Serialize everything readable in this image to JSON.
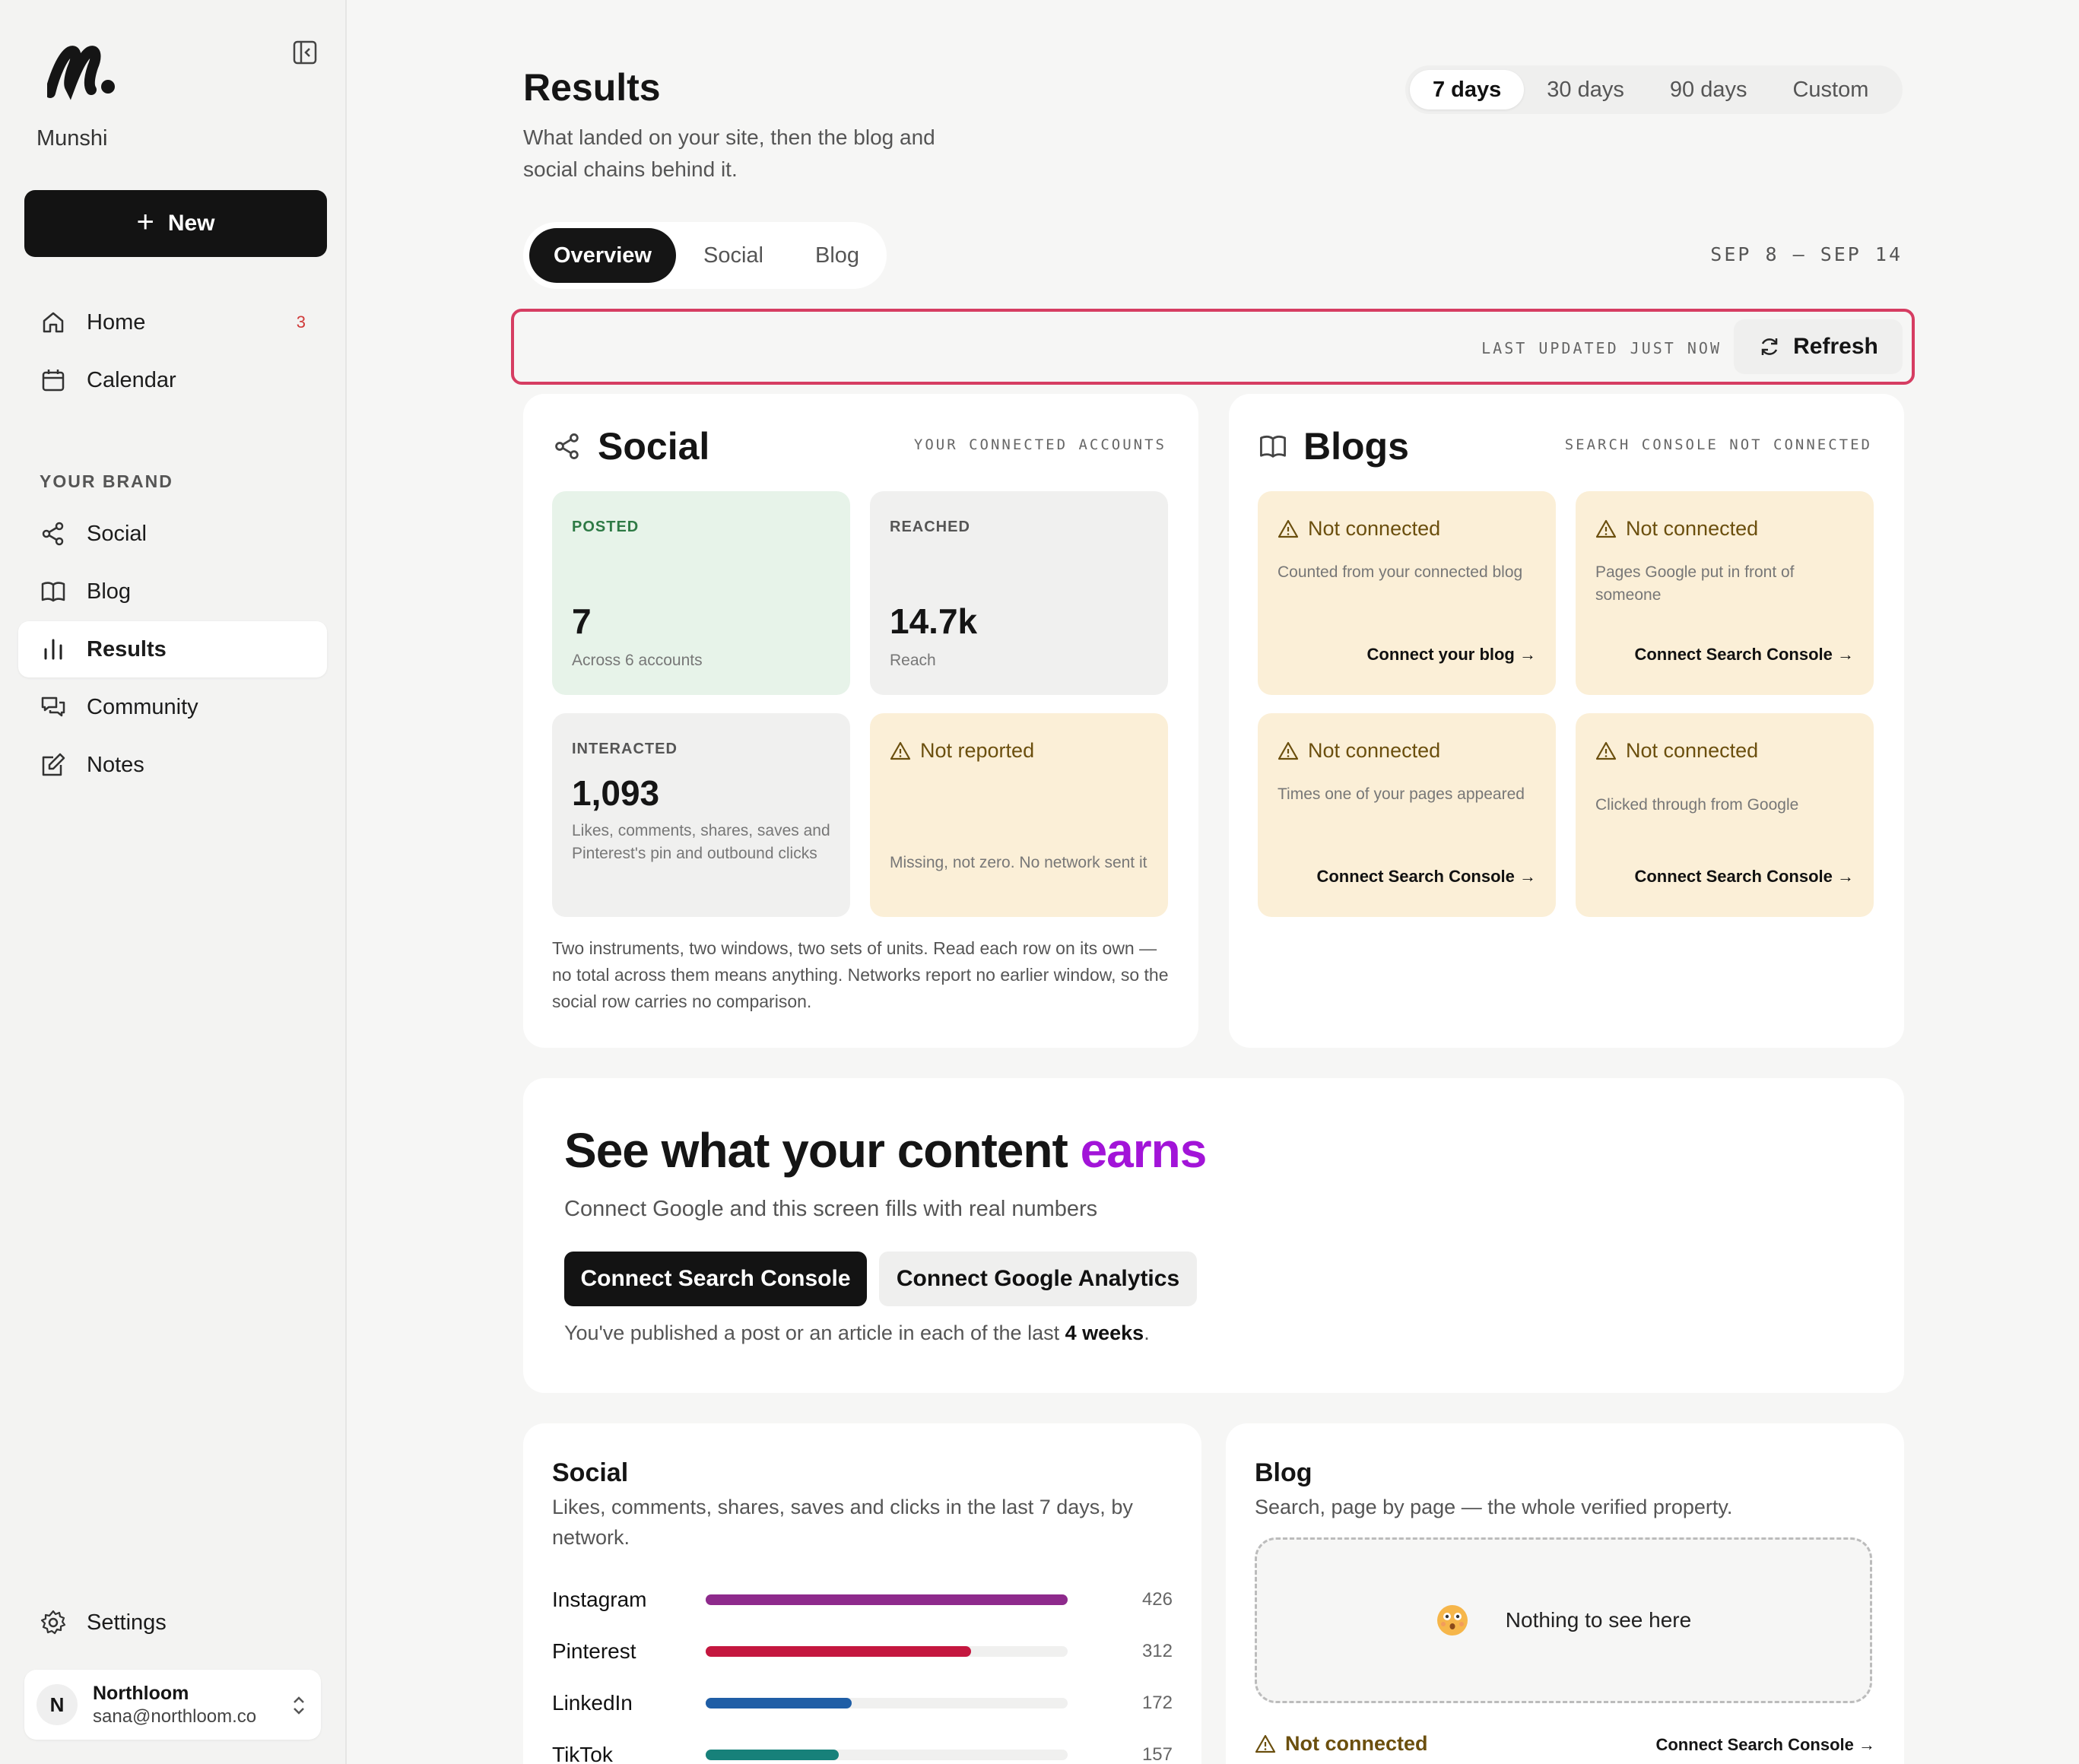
{
  "sidebar": {
    "brand": "Munshi",
    "new_label": "New",
    "nav": [
      {
        "label": "Home",
        "badge": "3"
      },
      {
        "label": "Calendar"
      }
    ],
    "section_label": "YOUR BRAND",
    "brand_nav": [
      {
        "label": "Social"
      },
      {
        "label": "Blog"
      },
      {
        "label": "Results"
      },
      {
        "label": "Community"
      },
      {
        "label": "Notes"
      }
    ],
    "settings_label": "Settings",
    "user": {
      "initial": "N",
      "name": "Northloom",
      "email": "sana@northloom.co"
    }
  },
  "header": {
    "title": "Results",
    "subtitle": "What landed on your site, then the blog and social chains behind it.",
    "ranges": [
      "7 days",
      "30 days",
      "90 days",
      "Custom"
    ],
    "active_range": "7 days",
    "views": [
      "Overview",
      "Social",
      "Blog"
    ],
    "active_view": "Overview",
    "date_range": "SEP 8 – SEP 14",
    "last_updated": "LAST UPDATED JUST NOW",
    "refresh_label": "Refresh"
  },
  "social_card": {
    "title": "Social",
    "meta": "YOUR CONNECTED ACCOUNTS",
    "posted": {
      "label": "POSTED",
      "value": "7",
      "caption": "Across 6 accounts"
    },
    "reached": {
      "label": "REACHED",
      "value": "14.7k",
      "caption": "Reach"
    },
    "interacted": {
      "label": "INTERACTED",
      "value": "1,093",
      "caption": "Likes, comments, shares, saves and Pinterest's pin and outbound clicks"
    },
    "not_reported": {
      "title": "Not reported",
      "caption": "Missing, not zero. No network sent it"
    },
    "footnote": "Two instruments, two windows, two sets of units. Read each row on its own — no total across them means anything. Networks report no earlier window, so the social row carries no comparison."
  },
  "blogs_card": {
    "title": "Blogs",
    "meta": "SEARCH CONSOLE NOT CONNECTED",
    "tiles": [
      {
        "title": "Not connected",
        "caption": "Counted from your connected blog",
        "link": "Connect your blog →"
      },
      {
        "title": "Not connected",
        "caption": "Pages Google put in front of someone",
        "link": "Connect Search Console →"
      },
      {
        "title": "Not connected",
        "caption": "Times one of your pages appeared",
        "link": "Connect Search Console →"
      },
      {
        "title": "Not connected",
        "caption": "Clicked through from Google",
        "link": "Connect Search Console →"
      }
    ]
  },
  "cta": {
    "title_main": "See what your content",
    "title_accent": "earns",
    "subtitle": "Connect Google and this screen fills with real numbers",
    "primary_button": "Connect Search Console",
    "secondary_button": "Connect Google Analytics",
    "note_prefix": "You've published a post or an article in each of the last",
    "note_bold": "4 weeks",
    "note_suffix": "."
  },
  "social_section": {
    "title": "Social",
    "subtitle": "Likes, comments, shares, saves and clicks in the last 7 days, by network.",
    "bars": [
      {
        "name": "Instagram",
        "value": 426,
        "value_label": "426",
        "color": "#8e2a8c"
      },
      {
        "name": "Pinterest",
        "value": 312,
        "value_label": "312",
        "color": "#c4173f"
      },
      {
        "name": "LinkedIn",
        "value": 172,
        "value_label": "172",
        "color": "#1f5ea6"
      },
      {
        "name": "TikTok",
        "value": 157,
        "value_label": "157",
        "color": "#17817a"
      }
    ],
    "bar_max": 426
  },
  "blog_section": {
    "title": "Blog",
    "subtitle": "Search, page by page — the whole verified property.",
    "empty_text": "Nothing to see here",
    "warn": "Not connected",
    "link": "Connect Search Console →"
  },
  "colors": {
    "accent": "#a214d8",
    "highlight_border": "#d63d62",
    "warning_bg": "#fbefd7",
    "posted_bg": "#e7f3e9"
  }
}
